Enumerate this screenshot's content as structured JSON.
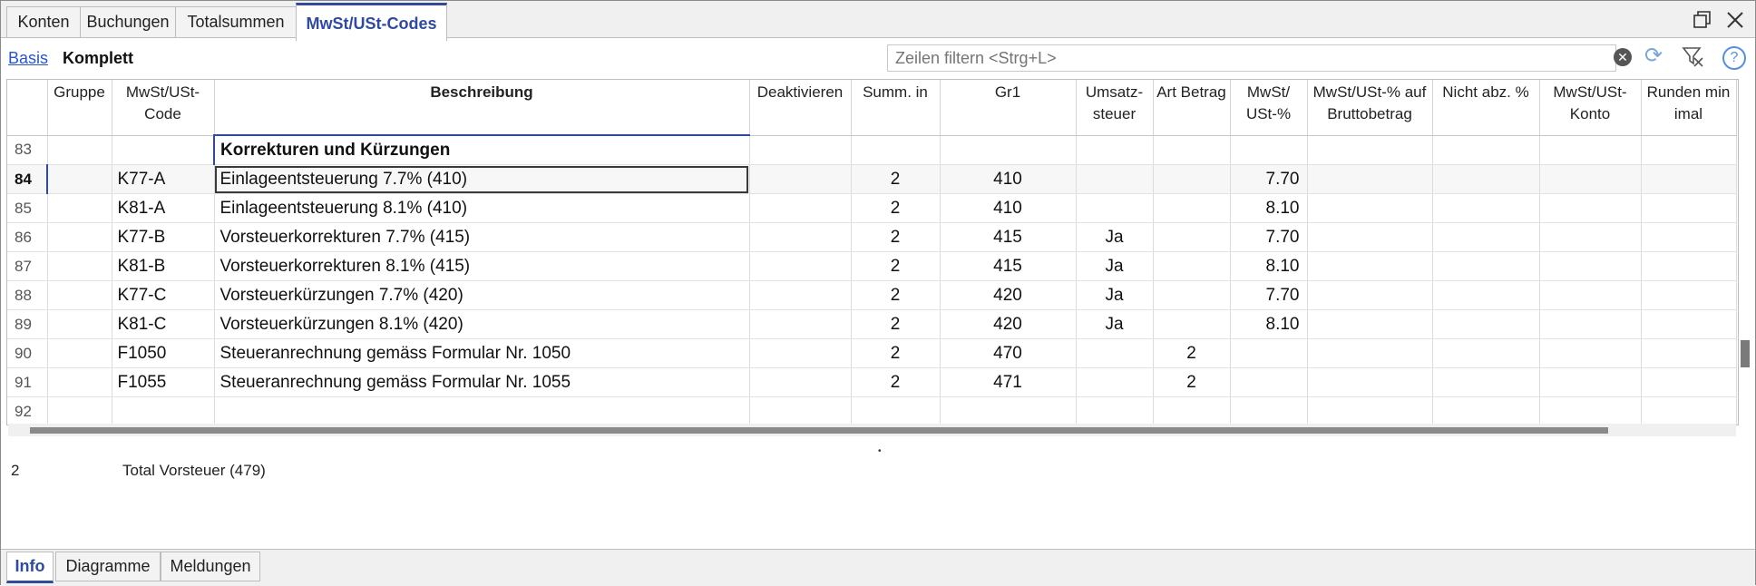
{
  "tabs": [
    {
      "label": "Konten",
      "active": false
    },
    {
      "label": "Buchungen",
      "active": false
    },
    {
      "label": "Totalsummen",
      "active": false
    },
    {
      "label": "MwSt/USt-Codes",
      "active": true
    }
  ],
  "window_controls": {
    "restore_icon": "restore-icon",
    "close_icon": "close-icon"
  },
  "views": {
    "basis": "Basis",
    "komplett": "Komplett"
  },
  "filter": {
    "placeholder": "Zeilen filtern <Strg+L>"
  },
  "columns": [
    "",
    "Gruppe",
    "MwSt/USt-Code",
    "Beschreibung",
    "Deaktivieren",
    "Summ. in",
    "Gr1",
    "Umsatz-steuer",
    "Art Betrag",
    "MwSt/USt-%",
    "MwSt/USt-% auf Bruttobetrag",
    "Nicht abz. %",
    "MwSt/USt-Konto",
    "Runden minimal"
  ],
  "column_headers": {
    "gruppe": "Gruppe",
    "code_1": "MwSt/USt-",
    "code_2": "Code",
    "beschreibung": "Beschreibung",
    "deaktivieren": "Deaktivieren",
    "summ_in": "Summ. in",
    "gr1": "Gr1",
    "umsatz_1": "Umsatz-",
    "umsatz_2": "steuer",
    "art_betrag": "Art Betrag",
    "pct_1": "MwSt/",
    "pct_2": "USt-%",
    "brutto_1": "MwSt/USt-% auf",
    "brutto_2": "Bruttobetrag",
    "nicht_abz": "Nicht abz. %",
    "konto_1": "MwSt/USt-",
    "konto_2": "Konto",
    "runden_1": "Runden min",
    "runden_2": "imal"
  },
  "rows": [
    {
      "rn": "83",
      "gruppe": "",
      "code": "",
      "desc": "Korrekturen und Kürzungen",
      "deakt": "",
      "summ": "",
      "gr1": "",
      "umsatz": "",
      "art": "",
      "pct": "",
      "brutto": "",
      "nicht": "",
      "konto": "",
      "runden": ""
    },
    {
      "rn": "84",
      "gruppe": "",
      "code": "K77-A",
      "desc": "Einlageentsteuerung  7.7% (410)",
      "deakt": "",
      "summ": "2",
      "gr1": "410",
      "umsatz": "",
      "art": "",
      "pct": "7.70",
      "brutto": "",
      "nicht": "",
      "konto": "",
      "runden": ""
    },
    {
      "rn": "85",
      "gruppe": "",
      "code": "K81-A",
      "desc": "Einlageentsteuerung  8.1% (410)",
      "deakt": "",
      "summ": "2",
      "gr1": "410",
      "umsatz": "",
      "art": "",
      "pct": "8.10",
      "brutto": "",
      "nicht": "",
      "konto": "",
      "runden": ""
    },
    {
      "rn": "86",
      "gruppe": "",
      "code": "K77-B",
      "desc": "Vorsteuerkorrekturen 7.7% (415)",
      "deakt": "",
      "summ": "2",
      "gr1": "415",
      "umsatz": "Ja",
      "art": "",
      "pct": "7.70",
      "brutto": "",
      "nicht": "",
      "konto": "",
      "runden": ""
    },
    {
      "rn": "87",
      "gruppe": "",
      "code": "K81-B",
      "desc": "Vorsteuerkorrekturen 8.1% (415)",
      "deakt": "",
      "summ": "2",
      "gr1": "415",
      "umsatz": "Ja",
      "art": "",
      "pct": "8.10",
      "brutto": "",
      "nicht": "",
      "konto": "",
      "runden": ""
    },
    {
      "rn": "88",
      "gruppe": "",
      "code": "K77-C",
      "desc": "Vorsteuerkürzungen 7.7% (420)",
      "deakt": "",
      "summ": "2",
      "gr1": "420",
      "umsatz": "Ja",
      "art": "",
      "pct": "7.70",
      "brutto": "",
      "nicht": "",
      "konto": "",
      "runden": ""
    },
    {
      "rn": "89",
      "gruppe": "",
      "code": "K81-C",
      "desc": "Vorsteuerkürzungen 8.1% (420)",
      "deakt": "",
      "summ": "2",
      "gr1": "420",
      "umsatz": "Ja",
      "art": "",
      "pct": "8.10",
      "brutto": "",
      "nicht": "",
      "konto": "",
      "runden": ""
    },
    {
      "rn": "90",
      "gruppe": "",
      "code": "F1050",
      "desc": "Steueranrechnung gemäss Formular Nr. 1050",
      "deakt": "",
      "summ": "2",
      "gr1": "470",
      "umsatz": "",
      "art": "2",
      "pct": "",
      "brutto": "",
      "nicht": "",
      "konto": "",
      "runden": ""
    },
    {
      "rn": "91",
      "gruppe": "",
      "code": "F1055",
      "desc": "Steueranrechnung gemäss Formular Nr. 1055",
      "deakt": "",
      "summ": "2",
      "gr1": "471",
      "umsatz": "",
      "art": "2",
      "pct": "",
      "brutto": "",
      "nicht": "",
      "konto": "",
      "runden": ""
    },
    {
      "rn": "92",
      "gruppe": "",
      "code": "",
      "desc": "",
      "deakt": "",
      "summ": "",
      "gr1": "",
      "umsatz": "",
      "art": "",
      "pct": "",
      "brutto": "",
      "nicht": "",
      "konto": "",
      "runden": ""
    }
  ],
  "selected_row": "84",
  "info": {
    "number": "2",
    "text": "Total Vorsteuer (479)"
  },
  "bottom_tabs": [
    {
      "label": "Info",
      "active": true
    },
    {
      "label": "Diagramme",
      "active": false
    },
    {
      "label": "Meldungen",
      "active": false
    }
  ],
  "colors": {
    "accent": "#2f4b9a",
    "link": "#2a55c5"
  }
}
